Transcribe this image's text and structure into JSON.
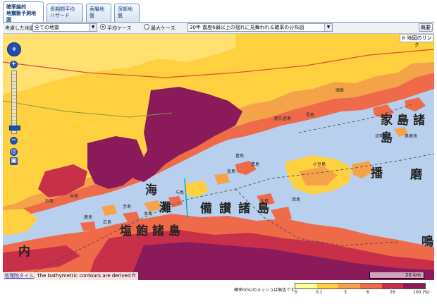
{
  "tabs": [
    {
      "line1": "確率論的",
      "line2": "地震動予測地図"
    },
    {
      "line1": "長期間平均",
      "line2": "ハザード"
    },
    {
      "line1": "表層地盤",
      "line2": ""
    },
    {
      "line1": "深部地盤",
      "line2": ""
    }
  ],
  "toolbar": {
    "earthquake_label": "考慮した地震",
    "earthquake_value": "全ての地震",
    "case_average": "平均ケース",
    "case_max": "最大ケース",
    "map_type_value": "30年 震度6弱以上の揺れに見舞われる確率の分布図",
    "overview_button": "概要"
  },
  "map": {
    "link_button": "地図のリンク",
    "labels": {
      "harima_ha": "播",
      "harima_ma": "磨",
      "ieshima": "家島諸島",
      "bisan": "備讃諸島",
      "shiwaku": "塩飽諸島",
      "nada": "灘",
      "umi": "海",
      "naru": "鳴",
      "uchi": "内"
    },
    "small_labels": [
      "鹿久居島",
      "長島",
      "頭島",
      "小豆島",
      "豊島",
      "直島",
      "本島",
      "手島",
      "与島",
      "広島",
      "鹿島",
      "西島",
      "坊勢島",
      "男鹿島",
      "家島",
      "井島",
      "石島",
      "豊島",
      "大島"
    ],
    "attribution_link": "地理院タイル",
    "attribution_text": ", The bathymetric contours are derived fr",
    "scale": "20 km"
  },
  "legend": {
    "note": "確率0(%)のメッシュは無色です。",
    "ticks": [
      "0",
      "0.1",
      "3",
      "6",
      "26",
      "100 (%)"
    ],
    "colors": [
      "#ffff96",
      "#ffd040",
      "#f5a348",
      "#ee6a48",
      "#c8304a",
      "#8a1a5a"
    ]
  }
}
